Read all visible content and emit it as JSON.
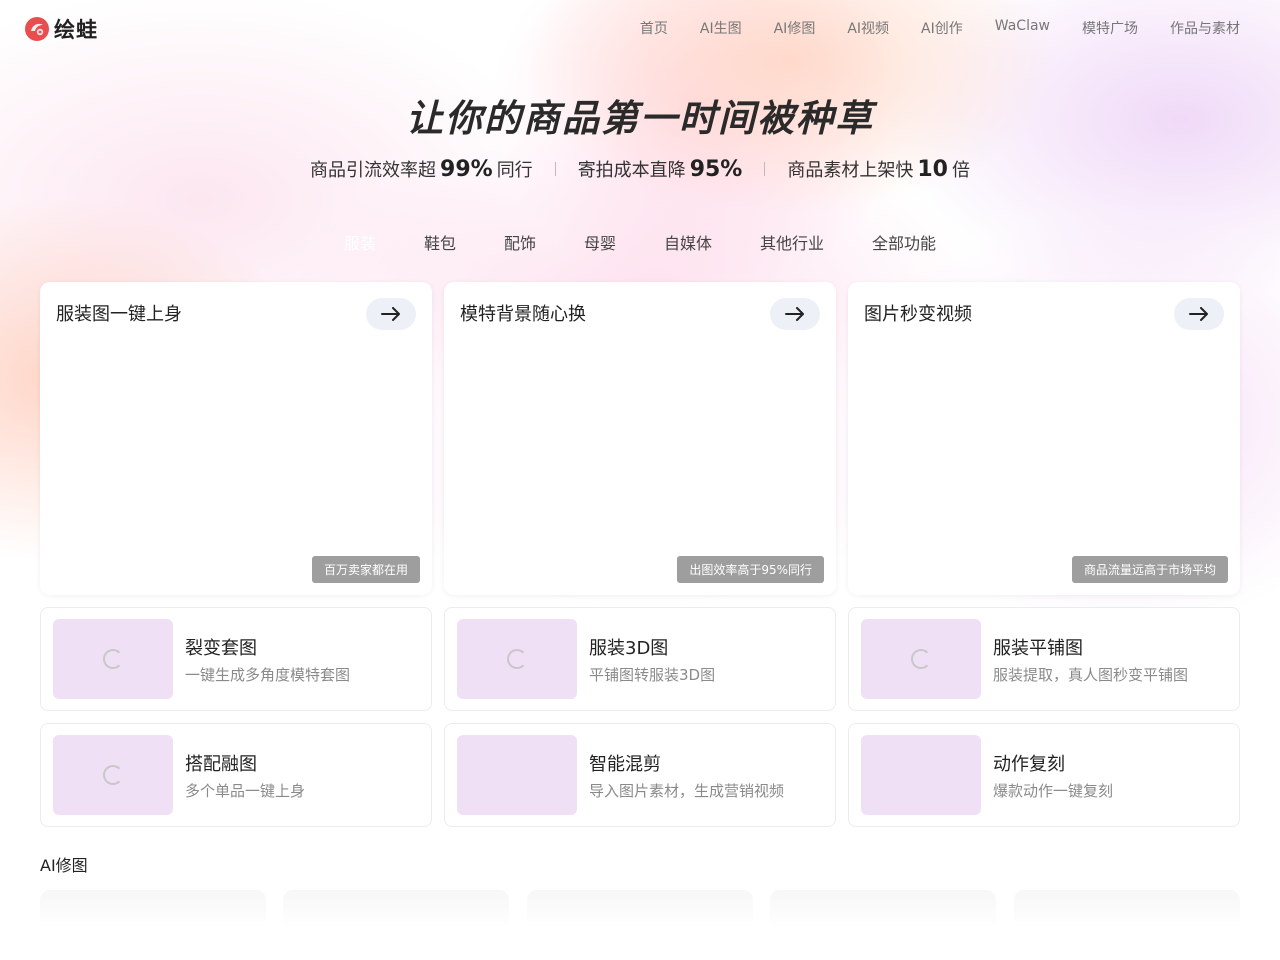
{
  "brand": {
    "name": "绘蛙",
    "color": "#e94e4e"
  },
  "nav": [
    "首页",
    "AI生图",
    "AI修图",
    "AI视频",
    "AI创作",
    "WaClaw",
    "模特广场",
    "作品与素材"
  ],
  "hero": {
    "title": "让你的商品第一时间被种草",
    "stats": [
      {
        "prefix": "商品引流效率超",
        "value": "99%",
        "suffix": "同行"
      },
      {
        "prefix": "寄拍成本直降",
        "value": "95%",
        "suffix": ""
      },
      {
        "prefix": "商品素材上架快",
        "value": "10",
        "suffix": "倍"
      }
    ]
  },
  "tabs": {
    "active": "服装",
    "items": [
      "服装",
      "鞋包",
      "配饰",
      "母婴",
      "自媒体",
      "其他行业",
      "全部功能"
    ]
  },
  "feature_cards": [
    {
      "title": "服装图一键上身",
      "badge": "百万卖家都在用"
    },
    {
      "title": "模特背景随心换",
      "badge": "出图效率高于95%同行"
    },
    {
      "title": "图片秒变视频",
      "badge": "商品流量远高于市场平均"
    }
  ],
  "tools": [
    {
      "title": "裂变套图",
      "desc": "一键生成多角度模特套图",
      "loading": true
    },
    {
      "title": "服装3D图",
      "desc": "平铺图转服装3D图",
      "loading": true
    },
    {
      "title": "服装平铺图",
      "desc": "服装提取，真人图秒变平铺图",
      "loading": true
    },
    {
      "title": "搭配融图",
      "desc": "多个单品一键上身",
      "loading": true
    },
    {
      "title": "智能混剪",
      "desc": "导入图片素材，生成营销视频",
      "loading": false
    },
    {
      "title": "动作复刻",
      "desc": "爆款动作一键复刻",
      "loading": false
    }
  ],
  "section": {
    "title": "AI修图"
  },
  "icons": {
    "arrow": "arrow-right-icon",
    "spinner": "loading-spinner-icon",
    "logo": "frog-logo-icon"
  },
  "colors": {
    "thumb_bg": "#efe0f6",
    "badge_bg": "#787878",
    "arrow_btn_bg": "#eef0f7"
  }
}
